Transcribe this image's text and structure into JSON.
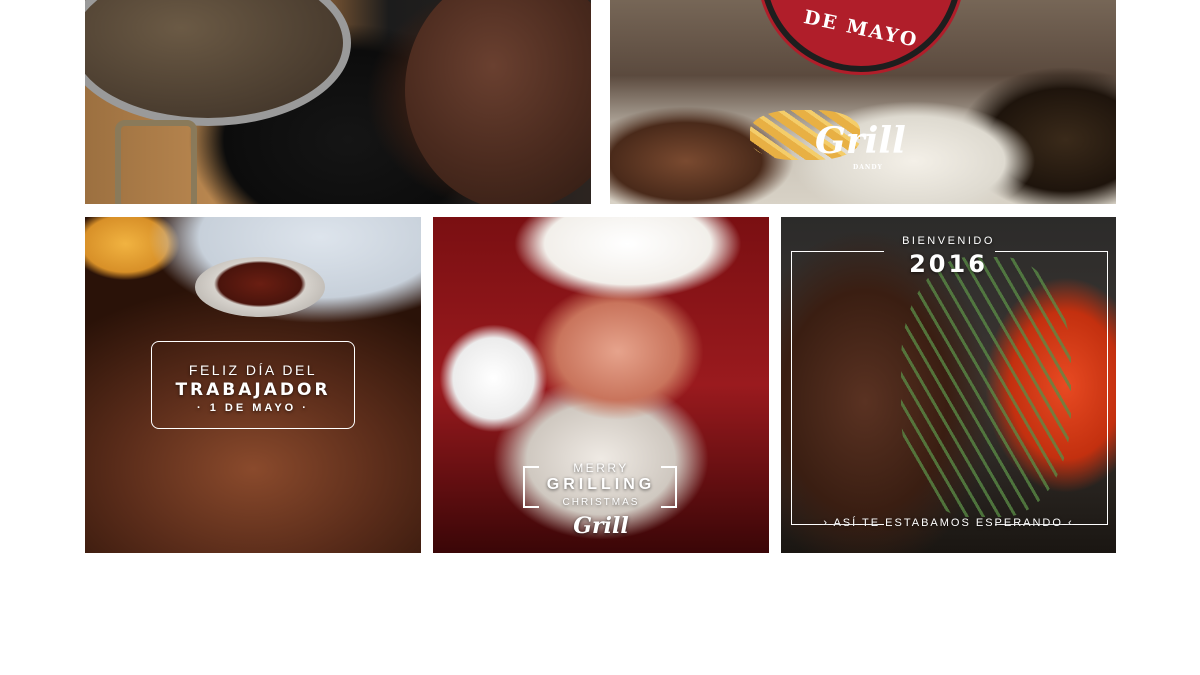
{
  "gallery": {
    "tile1": {
      "alt": "Grilled vegetables and steak on cast iron"
    },
    "tile2": {
      "badge_text": "DE MAYO",
      "logo": "Grill",
      "logo_sub": "DANDY"
    },
    "tile3": {
      "line1": "FELIZ DÍA DEL",
      "line2": "TRABAJADOR",
      "line3": "· 1 DE MAYO ·"
    },
    "tile4": {
      "line1": "MERRY",
      "line2": "GRILLING",
      "line3": "CHRISTMAS",
      "logo": "Grill"
    },
    "tile5": {
      "line1": "BIENVENIDO",
      "line2": "2016",
      "line3": "› ASÍ TE ESTABAMOS ESPERANDO ‹"
    }
  }
}
